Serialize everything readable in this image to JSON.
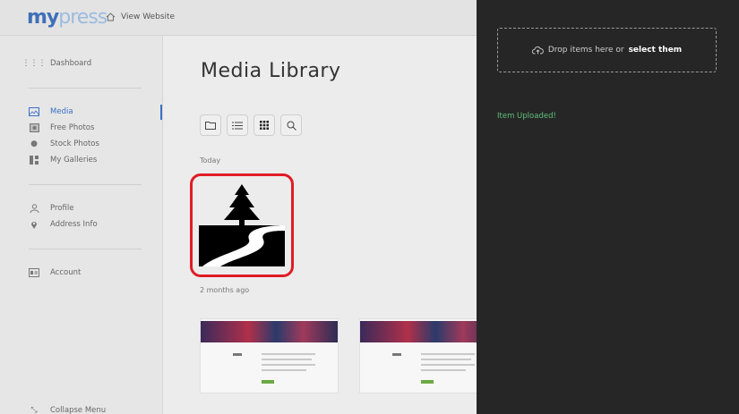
{
  "header": {
    "logo_my": "my",
    "logo_press": "press",
    "view_website": "View Website"
  },
  "sidebar": {
    "items": [
      {
        "label": "Dashboard",
        "icon": "grid-icon"
      },
      {
        "label": "Media",
        "icon": "image-icon",
        "active": true
      },
      {
        "label": "Free Photos",
        "icon": "photo-icon"
      },
      {
        "label": "Stock Photos",
        "icon": "camera-icon"
      },
      {
        "label": "My Galleries",
        "icon": "galleries-icon"
      },
      {
        "label": "Profile",
        "icon": "user-icon"
      },
      {
        "label": "Address Info",
        "icon": "location-pin-icon"
      },
      {
        "label": "Account",
        "icon": "id-card-icon"
      },
      {
        "label": "Collapse Menu",
        "icon": "collapse-arrows-icon"
      }
    ]
  },
  "main": {
    "title": "Media Library",
    "toolbar": [
      "folder-icon",
      "list-view-icon",
      "grid-view-icon",
      "search-icon"
    ],
    "sections": {
      "today": "Today",
      "two_months_ago": "2 months ago"
    }
  },
  "upload_panel": {
    "drop_text": "Drop items here or",
    "select_link": "select them",
    "status_message": "Item Uploaded!"
  },
  "colors": {
    "accent": "#3b6fc4",
    "highlight": "#e01c24",
    "panel_bg": "#262626",
    "success": "#5ec27a"
  }
}
